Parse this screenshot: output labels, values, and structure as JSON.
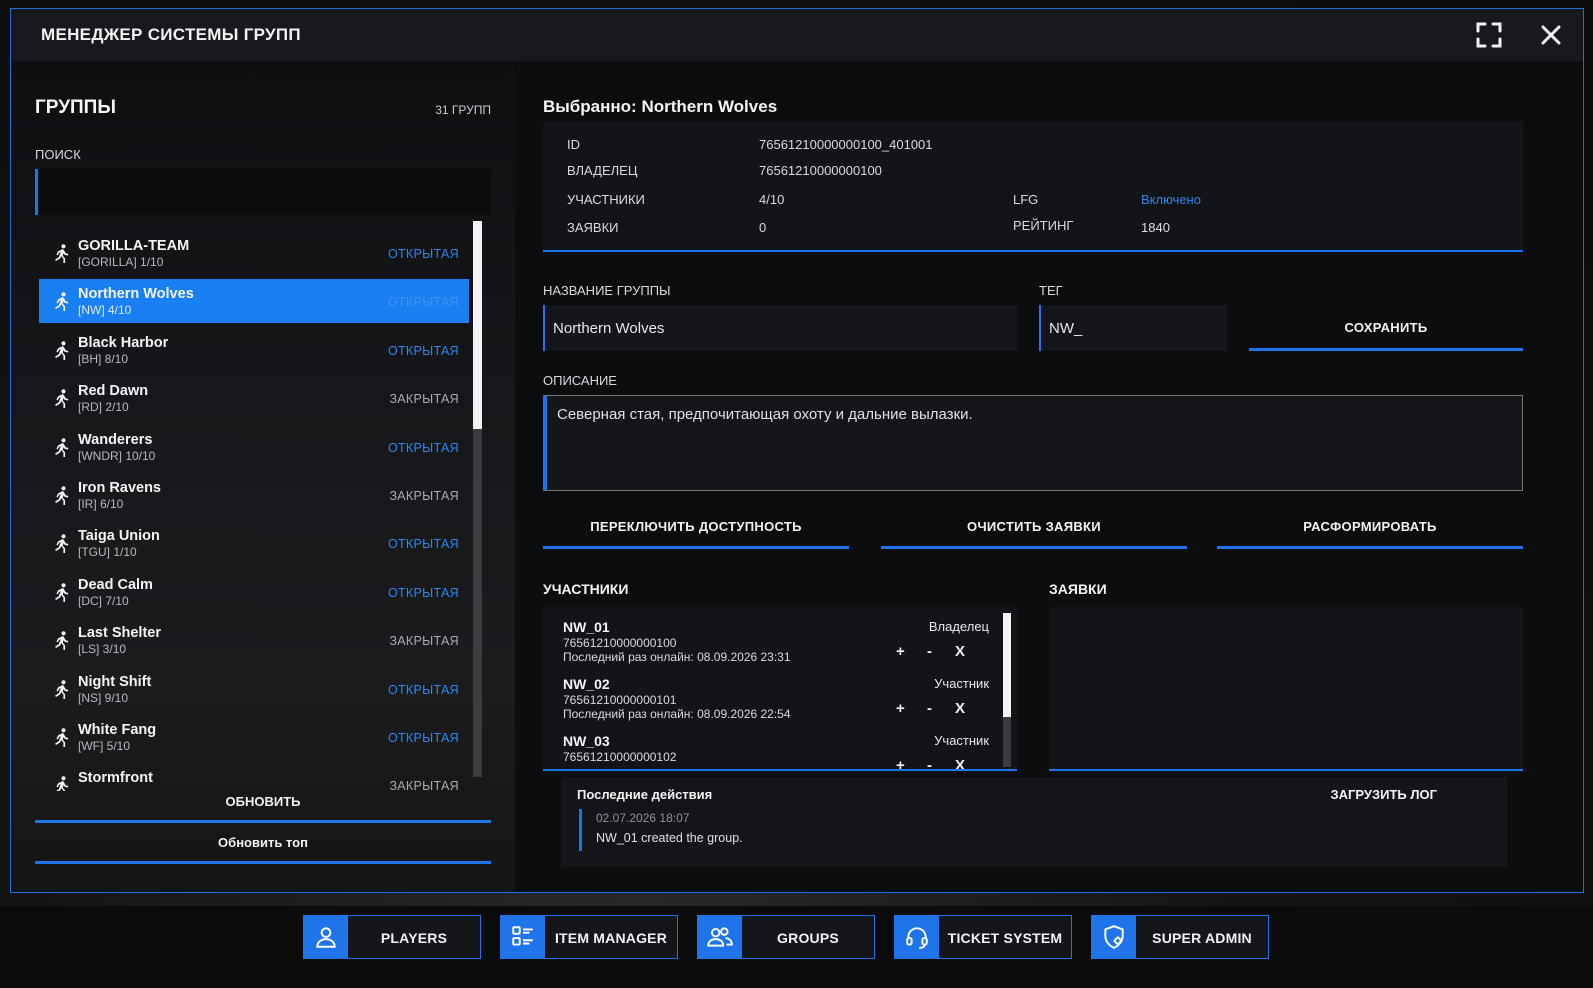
{
  "window": {
    "title": "МЕНЕДЖЕР СИСТЕМЫ ГРУПП"
  },
  "left": {
    "heading": "ГРУППЫ",
    "count": "31 ГРУПП",
    "search_label": "ПОИСК",
    "search_value": "",
    "refresh_label": "ОБНОВИТЬ",
    "refresh_top_label": "Обновить топ",
    "groups": [
      {
        "name": "GORILLA-TEAM",
        "sub": "[GORILLA] 1/10",
        "status": "ОТКРЫТАЯ",
        "open": true
      },
      {
        "name": "Northern Wolves",
        "sub": "[NW] 4/10",
        "status": "ОТКРЫТАЯ",
        "open": true
      },
      {
        "name": "Black Harbor",
        "sub": "[BH] 8/10",
        "status": "ОТКРЫТАЯ",
        "open": true
      },
      {
        "name": "Red Dawn",
        "sub": "[RD] 2/10",
        "status": "ЗАКРЫТАЯ",
        "open": false
      },
      {
        "name": "Wanderers",
        "sub": "[WNDR] 10/10",
        "status": "ОТКРЫТАЯ",
        "open": true
      },
      {
        "name": "Iron Ravens",
        "sub": "[IR] 6/10",
        "status": "ЗАКРЫТАЯ",
        "open": false
      },
      {
        "name": "Taiga Union",
        "sub": "[TGU] 1/10",
        "status": "ОТКРЫТАЯ",
        "open": true
      },
      {
        "name": "Dead Calm",
        "sub": "[DC] 7/10",
        "status": "ОТКРЫТАЯ",
        "open": true
      },
      {
        "name": "Last Shelter",
        "sub": "[LS] 3/10",
        "status": "ЗАКРЫТАЯ",
        "open": false
      },
      {
        "name": "Night Shift",
        "sub": "[NS] 9/10",
        "status": "ОТКРЫТАЯ",
        "open": true
      },
      {
        "name": "White Fang",
        "sub": "[WF] 5/10",
        "status": "ОТКРЫТАЯ",
        "open": true
      },
      {
        "name": "Stormfront",
        "sub": "",
        "status": "ЗАКРЫТАЯ",
        "open": false
      }
    ]
  },
  "selected": {
    "title": "Выбранно: Northern Wolves",
    "info": {
      "id_label": "ID",
      "id_value": "76561210000000100_401001",
      "owner_label": "ВЛАДЕЛЕЦ",
      "owner_value": "76561210000000100",
      "members_label": "УЧАСТНИКИ",
      "members_value": "4/10",
      "requests_label": "ЗАЯВКИ",
      "requests_value": "0",
      "lfg_label": "LFG",
      "lfg_value": "Включено",
      "rating_label": "РЕЙТИНГ",
      "rating_value": "1840"
    },
    "name_label": "НАЗВАНИЕ ГРУППЫ",
    "name_value": "Northern Wolves",
    "tag_label": "ТЕГ",
    "tag_value": "NW_",
    "save_label": "СОХРАНИТЬ",
    "description_label": "ОПИСАНИЕ",
    "description_value": "Северная стая, предпочитающая охоту и дальние вылазки.",
    "toggle_label": "ПЕРЕКЛЮЧИТЬ ДОСТУПНОСТЬ",
    "clear_label": "ОЧИСТИТЬ ЗАЯВКИ",
    "disband_label": "РАСФОРМИРОВАТЬ",
    "members_heading": "УЧАСТНИКИ",
    "requests_heading": "ЗАЯВКИ",
    "members": [
      {
        "name": "NW_01",
        "id": "76561210000000100",
        "last": "Последний раз онлайн: 08.09.2026 23:31",
        "role": "Владелец"
      },
      {
        "name": "NW_02",
        "id": "76561210000000101",
        "last": "Последний раз онлайн: 08.09.2026 22:54",
        "role": "Участник"
      },
      {
        "name": "NW_03",
        "id": "76561210000000102",
        "last": "",
        "role": "Участник"
      }
    ],
    "actions": {
      "plus": "+",
      "minus": "-",
      "kick": "X"
    },
    "log": {
      "title": "Последние действия",
      "load_label": "ЗАГРУЗИТЬ ЛОГ",
      "entries": [
        {
          "time": "02.07.2026 18:07",
          "text": "NW_01 created the group."
        }
      ]
    }
  },
  "bottom_nav": [
    {
      "label": "PLAYERS",
      "icon": "user-icon"
    },
    {
      "label": "ITEM MANAGER",
      "icon": "list-icon"
    },
    {
      "label": "GROUPS",
      "icon": "users-icon"
    },
    {
      "label": "TICKET SYSTEM",
      "icon": "headset-icon"
    },
    {
      "label": "SUPER ADMIN",
      "icon": "shield-gear-icon"
    }
  ],
  "colors": {
    "accent": "#1e74e8",
    "selected_row": "#1a7ff0",
    "open_status": "#2d86f0"
  }
}
